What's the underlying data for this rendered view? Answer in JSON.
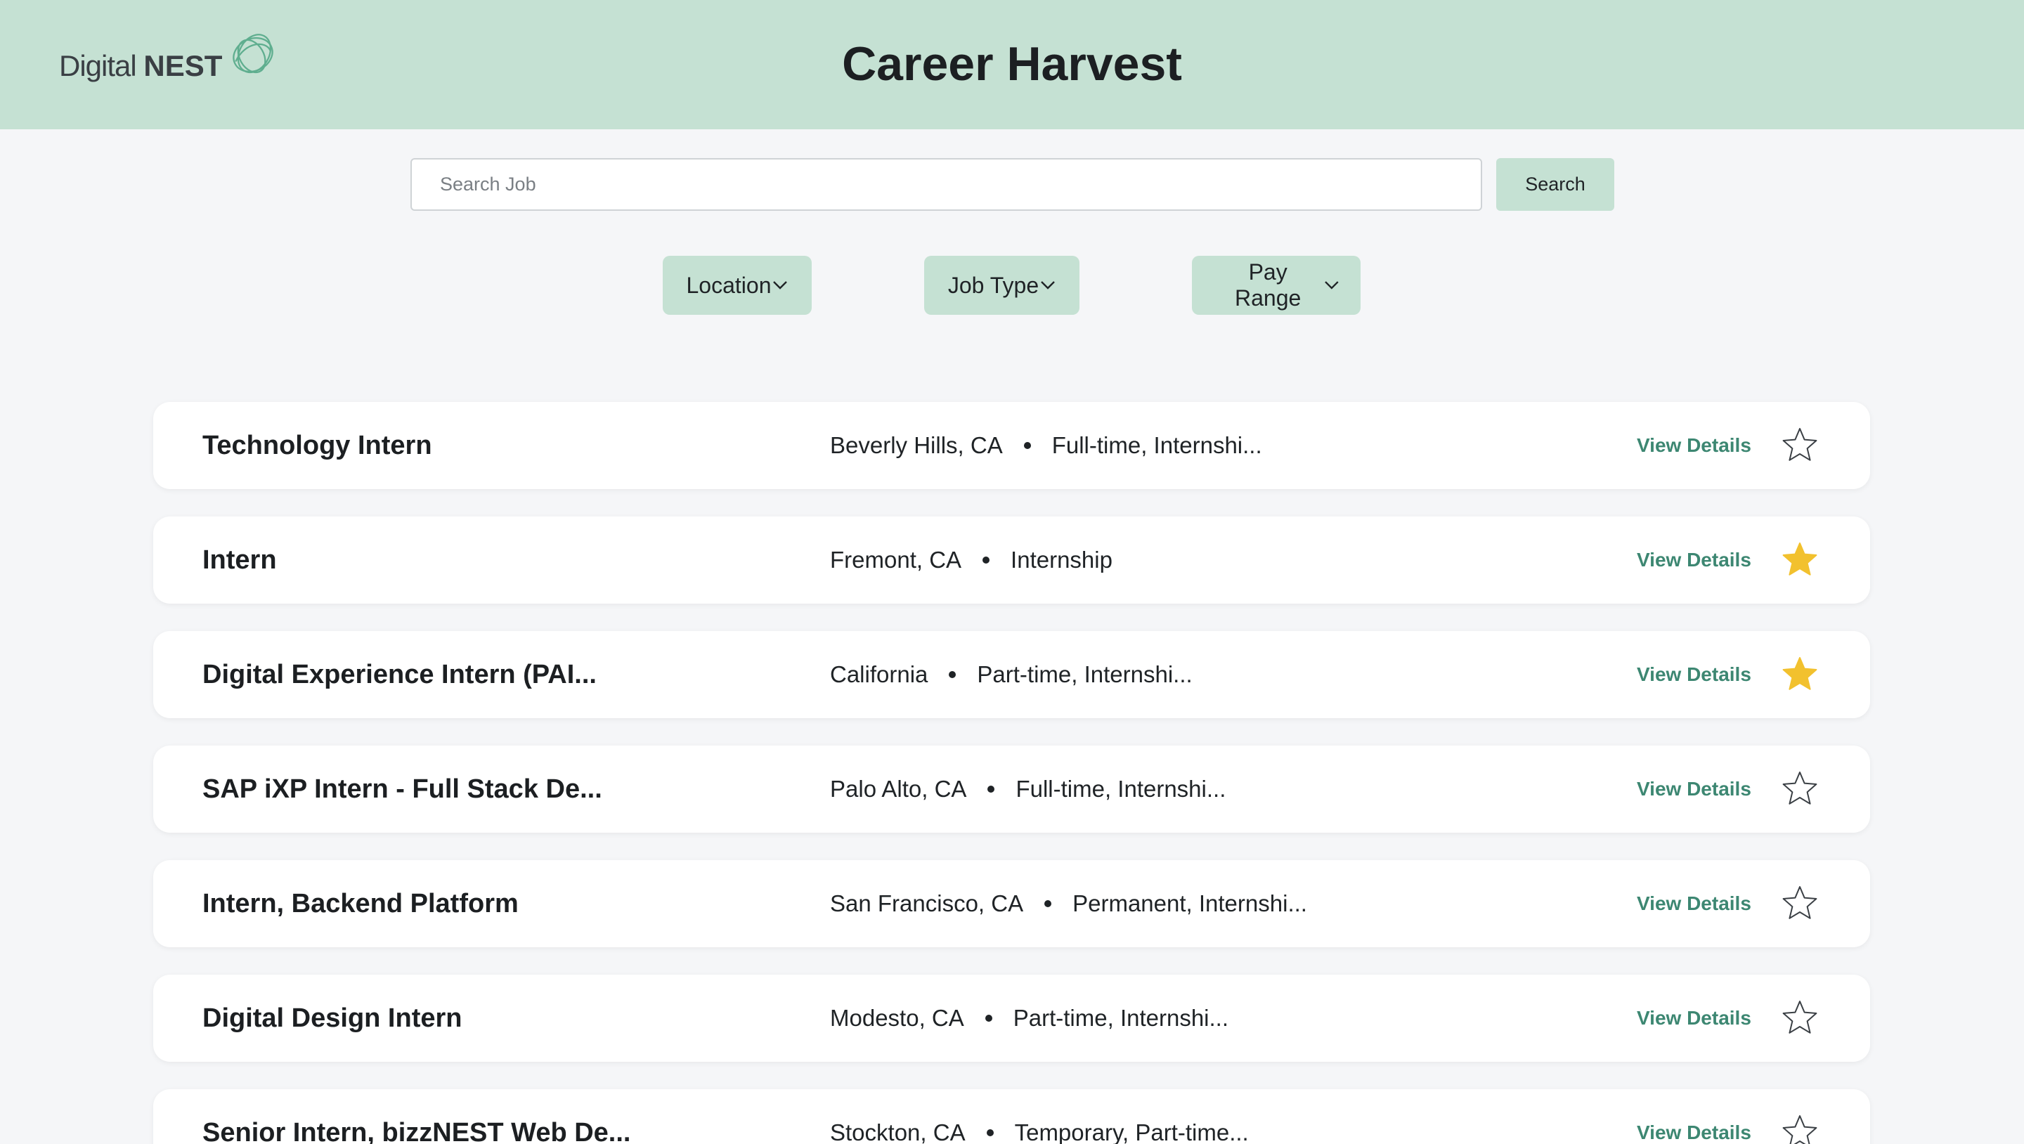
{
  "header": {
    "logo_text_light": "Digital",
    "logo_text_bold": "NEST",
    "title": "Career Harvest"
  },
  "search": {
    "placeholder": "Search Job",
    "value": "",
    "button_label": "Search"
  },
  "filters": [
    {
      "label": "Location"
    },
    {
      "label": "Job Type"
    },
    {
      "label": "Pay Range"
    }
  ],
  "jobs": [
    {
      "title": "Technology Intern",
      "location": "Beverly Hills, CA",
      "type": "Full-time, Internshi...",
      "details_label": "View Details",
      "starred": false
    },
    {
      "title": "Intern",
      "location": "Fremont, CA",
      "type": "Internship",
      "details_label": "View Details",
      "starred": true
    },
    {
      "title": "Digital Experience Intern (PAI...",
      "location": "California",
      "type": "Part-time, Internshi...",
      "details_label": "View Details",
      "starred": true
    },
    {
      "title": "SAP iXP Intern - Full Stack De...",
      "location": "Palo Alto, CA",
      "type": "Full-time, Internshi...",
      "details_label": "View Details",
      "starred": false
    },
    {
      "title": "Intern, Backend Platform",
      "location": "San Francisco, CA",
      "type": "Permanent, Internshi...",
      "details_label": "View Details",
      "starred": false
    },
    {
      "title": "Digital Design Intern",
      "location": "Modesto, CA",
      "type": "Part-time, Internshi...",
      "details_label": "View Details",
      "starred": false
    },
    {
      "title": "Senior Intern, bizzNEST Web De...",
      "location": "Stockton, CA",
      "type": "Temporary, Part-time...",
      "details_label": "View Details",
      "starred": false
    }
  ],
  "colors": {
    "accent": "#c5e1d3",
    "link": "#3d8772",
    "star_filled": "#f2c12e",
    "star_outline": "#3a3f44"
  },
  "icons": {
    "logo": "nest-swirl-logo",
    "filter_chevron": "chevron-down-icon",
    "favorite": "star-icon"
  }
}
